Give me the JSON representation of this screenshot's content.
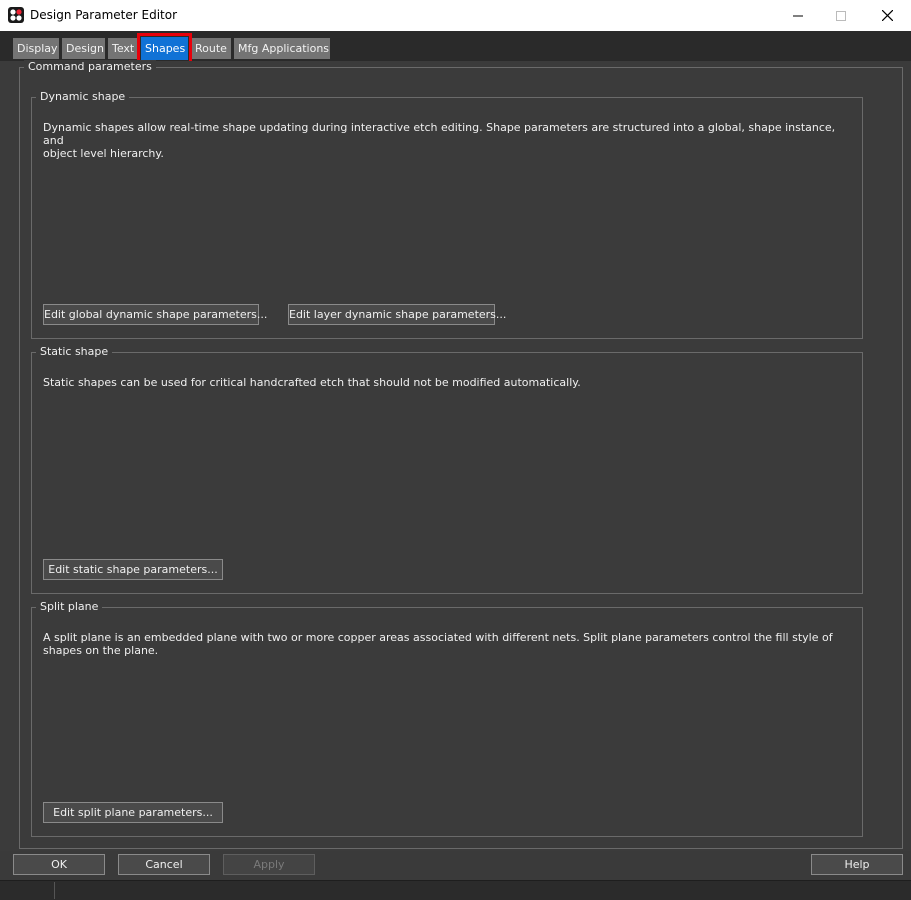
{
  "window": {
    "title": "Design Parameter Editor",
    "icon": "app-logo-icon"
  },
  "tabs": [
    {
      "label": "Display"
    },
    {
      "label": "Design"
    },
    {
      "label": "Text"
    },
    {
      "label": "Shapes",
      "active": true
    },
    {
      "label": "Route"
    },
    {
      "label": "Mfg Applications"
    }
  ],
  "command_parameters": {
    "title": "Command parameters",
    "dynamic_shape": {
      "title": "Dynamic shape",
      "description": "Dynamic shapes allow real-time shape updating during interactive etch editing.  Shape parameters are structured into a global, shape instance, and\nobject level hierarchy.",
      "global_button": "Edit global dynamic shape parameters...",
      "layer_button": "Edit layer dynamic shape parameters..."
    },
    "static_shape": {
      "title": "Static shape",
      "description": "Static shapes can be used for critical handcrafted etch that should not be modified automatically.",
      "button": "Edit static shape parameters..."
    },
    "split_plane": {
      "title": "Split plane",
      "description": "A split plane is an embedded plane with two or more copper areas associated with different nets.  Split plane parameters control the fill style of\nshapes on the plane.",
      "button": "Edit split plane parameters..."
    }
  },
  "footer": {
    "ok": "OK",
    "cancel": "Cancel",
    "apply": "Apply",
    "help": "Help"
  },
  "colors": {
    "active_tab": "#1072d6",
    "highlight": "#e8000a"
  }
}
